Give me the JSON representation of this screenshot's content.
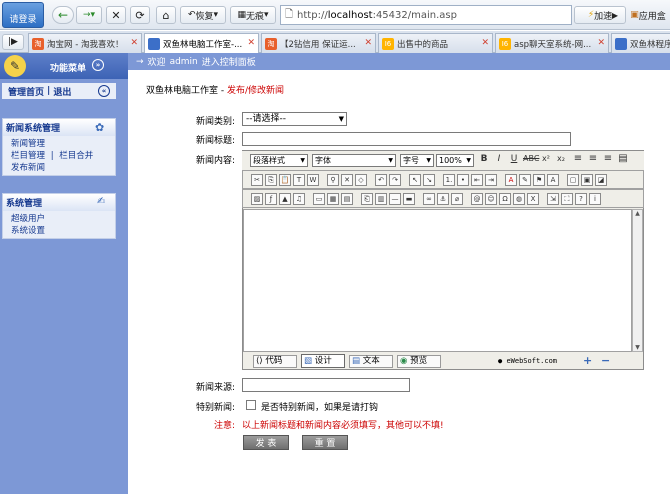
{
  "browser": {
    "login_label": "请登录",
    "back_icon": "back-arrow-icon",
    "forward_icon": "forward-arrow-icon",
    "restore_label": "恢复",
    "noimage_label": "无痕",
    "url_prefix": "http://",
    "url_host": "localhost",
    "url_rest": ":45432/main.asp",
    "speedup_label": "加速",
    "app_label": "应用盒"
  },
  "tabs": [
    {
      "label": "淘宝网 - 淘我喜欢！",
      "icon_color": "#e8602c",
      "icon_text": "淘"
    },
    {
      "label": "双鱼林电脑工作室-...",
      "icon_color": "#3c6fc8",
      "icon_text": "",
      "active": true
    },
    {
      "label": "【2钻信用 保证运...",
      "icon_color": "#e8602c",
      "icon_text": "淘"
    },
    {
      "label": "出售中的商品",
      "icon_color": "#ffb400",
      "icon_text": "I6"
    },
    {
      "label": "asp聊天室系统-网...",
      "icon_color": "#ffb400",
      "icon_text": "I6"
    },
    {
      "label": "双鱼林程序",
      "icon_color": "#3c6fc8",
      "icon_text": ""
    }
  ],
  "sidebar": {
    "header": "功能菜单",
    "home": "管理首页",
    "sep": "|",
    "logout": "退出",
    "sections": [
      {
        "title": "新闻系统管理",
        "items": [
          [
            "新闻管理"
          ],
          [
            "栏目管理",
            "|",
            "栏目合并"
          ],
          [
            "发布新闻"
          ]
        ]
      },
      {
        "title": "系统管理",
        "items": [
          [
            "超级用户"
          ],
          [
            "系统设置"
          ]
        ]
      }
    ]
  },
  "mainbar": {
    "welcome": "欢迎",
    "user": "admin",
    "rest": "进入控制面板"
  },
  "page": {
    "studio": "双鱼林电脑工作室",
    "dash": " - ",
    "action": "发布/修改新闻"
  },
  "form": {
    "category_label": "新闻类别:",
    "category_value": "--请选择--",
    "title_label": "新闻标题:",
    "title_value": "",
    "content_label": "新闻内容:",
    "source_label": "新闻来源:",
    "source_value": "",
    "special_label": "特别新闻:",
    "special_check": "是否特别新闻，如果是请打钩",
    "note_label": "注意:",
    "note_text": "以上新闻标题和新闻内容必须填写，其他可以不填!",
    "submit": "发 表",
    "reset": "重 置"
  },
  "editor": {
    "para_style": "段落样式",
    "font": "字体",
    "size": "字号",
    "zoom": "100%",
    "modes": [
      "代码",
      "设计",
      "文本",
      "预览"
    ],
    "brand": "eWebSoft.com"
  },
  "colors": {
    "sidebar_bg": "#7d98d6",
    "accent_red": "#cc0000",
    "link_blue": "#16398f"
  }
}
